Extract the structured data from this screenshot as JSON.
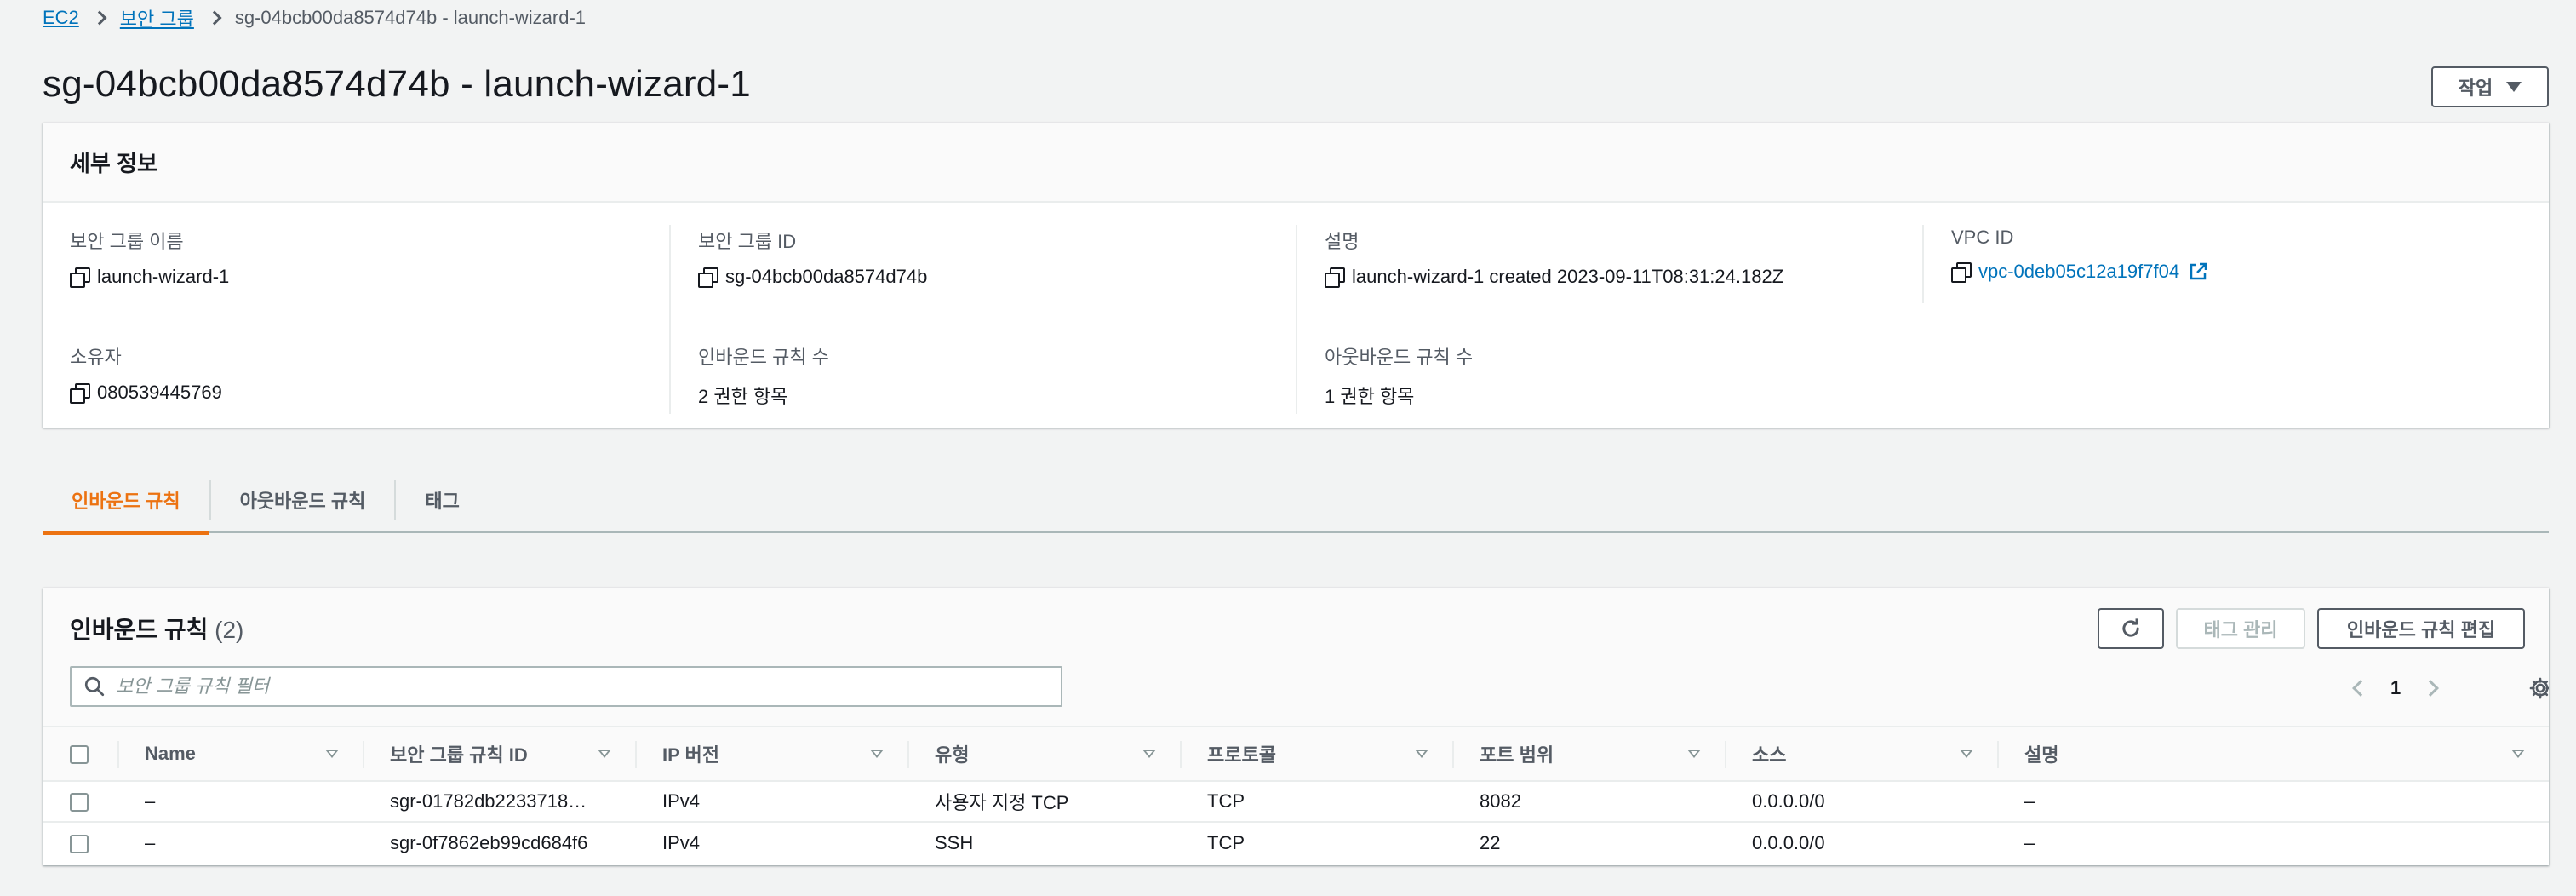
{
  "breadcrumb": {
    "items": [
      {
        "label": "EC2"
      },
      {
        "label": "보안 그룹"
      }
    ],
    "current": "sg-04bcb00da8574d74b - launch-wizard-1"
  },
  "header": {
    "title": "sg-04bcb00da8574d74b - launch-wizard-1",
    "actions_label": "작업"
  },
  "details": {
    "title": "세부 정보",
    "sg_name_label": "보안 그룹 이름",
    "sg_name": "launch-wizard-1",
    "sg_id_label": "보안 그룹 ID",
    "sg_id": "sg-04bcb00da8574d74b",
    "desc_label": "설명",
    "desc": "launch-wizard-1 created 2023-09-11T08:31:24.182Z",
    "vpc_label": "VPC ID",
    "vpc": "vpc-0deb05c12a19f7f04",
    "owner_label": "소유자",
    "owner": "080539445769",
    "inbound_count_label": "인바운드 규칙 수",
    "inbound_count": "2 권한 항목",
    "outbound_count_label": "아웃바운드 규칙 수",
    "outbound_count": "1 권한 항목"
  },
  "tabs": [
    {
      "label": "인바운드 규칙",
      "active": true
    },
    {
      "label": "아웃바운드 규칙",
      "active": false
    },
    {
      "label": "태그",
      "active": false
    }
  ],
  "rules": {
    "title": "인바운드 규칙",
    "count": "(2)",
    "tag_manage_label": "태그 관리",
    "edit_label": "인바운드 규칙 편집",
    "filter_placeholder": "보안 그룹 규칙 필터",
    "page": "1",
    "columns": [
      "Name",
      "보안 그룹 규칙 ID",
      "IP 버전",
      "유형",
      "프로토콜",
      "포트 범위",
      "소스",
      "설명"
    ],
    "rows": [
      {
        "name": "–",
        "rule_id": "sgr-01782db2233718…",
        "ip_version": "IPv4",
        "type": "사용자 지정 TCP",
        "protocol": "TCP",
        "port": "8082",
        "source": "0.0.0.0/0",
        "desc": "–"
      },
      {
        "name": "–",
        "rule_id": "sgr-0f7862eb99cd684f6",
        "ip_version": "IPv4",
        "type": "SSH",
        "protocol": "TCP",
        "port": "22",
        "source": "0.0.0.0/0",
        "desc": "–"
      }
    ]
  },
  "colors": {
    "link": "#0073bb",
    "active_tab": "#ec7211",
    "text": "#16191f",
    "secondary_text": "#545b64"
  },
  "icons": [
    "chevron-right-icon",
    "caret-down-icon",
    "copy-icon",
    "external-link-icon",
    "refresh-icon",
    "search-icon",
    "chevron-left-icon",
    "settings-gear-icon",
    "sort-caret-icon"
  ]
}
